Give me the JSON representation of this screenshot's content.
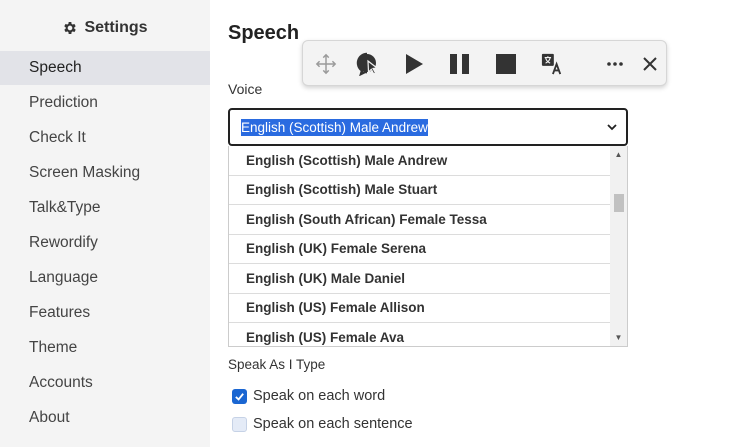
{
  "sidebar": {
    "title": "Settings",
    "items": [
      {
        "label": "Speech",
        "active": true
      },
      {
        "label": "Prediction"
      },
      {
        "label": "Check It"
      },
      {
        "label": "Screen Masking"
      },
      {
        "label": "Talk&Type"
      },
      {
        "label": "Rewordify"
      },
      {
        "label": "Language"
      },
      {
        "label": "Features"
      },
      {
        "label": "Theme"
      },
      {
        "label": "Accounts"
      },
      {
        "label": "About"
      }
    ]
  },
  "main": {
    "title": "Speech",
    "voice_label": "Voice",
    "voice_selected": "English (Scottish) Male Andrew",
    "voice_options": [
      "English (Scottish) Male Andrew",
      "English (Scottish) Male Stuart",
      "English (South African) Female Tessa",
      "English (UK) Female Serena",
      "English (UK) Male Daniel",
      "English (US) Female Allison",
      "English (US) Female Ava"
    ],
    "speak_as_i_type_label": "Speak As I Type",
    "speak_each_word": {
      "label": "Speak on each word",
      "checked": true
    },
    "speak_each_sentence": {
      "label": "Speak on each sentence",
      "checked": false
    }
  },
  "toolbar": {
    "icons": [
      "move-icon",
      "click-to-speak-icon",
      "play-icon",
      "pause-icon",
      "stop-icon",
      "translate-icon",
      "more-icon",
      "close-icon"
    ]
  },
  "colors": {
    "sidebar_bg": "#f4f4f4",
    "active_item_bg": "#e2e3e8",
    "accent_blue": "#1a66d2",
    "selection_blue": "#2a6be0",
    "toolbar_icon": "#333333"
  }
}
